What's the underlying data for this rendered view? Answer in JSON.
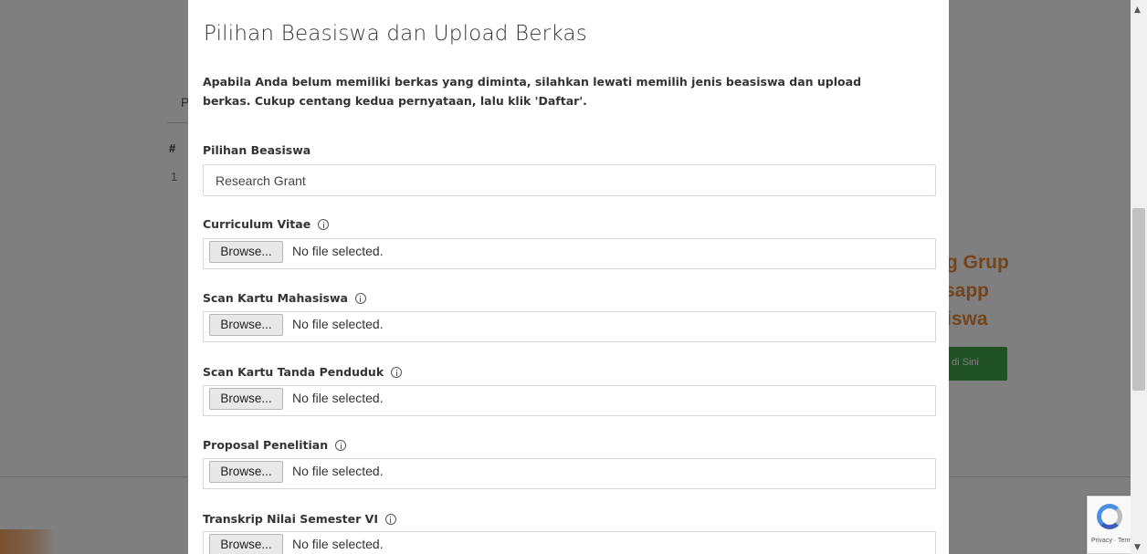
{
  "background": {
    "table_header": "#",
    "table_row_number": "1",
    "heading_fragment": "P",
    "promo_lines": [
      "g Grup",
      "sapp",
      "iswa"
    ],
    "promo_button_label": "di Sini",
    "promo_color": "#e8883a",
    "button_color": "#3fa24a"
  },
  "modal": {
    "title": "Pilihan Beasiswa dan Upload Berkas",
    "intro": "Apabila Anda belum memiliki berkas yang diminta, silahkan lewati memilih jenis beasiswa dan upload berkas. Cukup centang kedua pernyataan, lalu klik 'Daftar'.",
    "scholarship": {
      "label": "Pilihan Beasiswa",
      "selected_value": "Research Grant"
    },
    "uploads": [
      {
        "label": "Curriculum Vitae",
        "button": "Browse...",
        "status": "No file selected.",
        "icon": "info-icon"
      },
      {
        "label": "Scan Kartu Mahasiswa",
        "button": "Browse...",
        "status": "No file selected.",
        "icon": "info-icon"
      },
      {
        "label": "Scan Kartu Tanda Penduduk",
        "button": "Browse...",
        "status": "No file selected.",
        "icon": "info-icon"
      },
      {
        "label": "Proposal Penelitian",
        "button": "Browse...",
        "status": "No file selected.",
        "icon": "info-icon"
      },
      {
        "label": "Transkrip Nilai Semester VI",
        "button": "Browse...",
        "status": "No file selected.",
        "icon": "info-icon"
      }
    ]
  },
  "recaptcha": {
    "text": "Privacy · Terms"
  }
}
